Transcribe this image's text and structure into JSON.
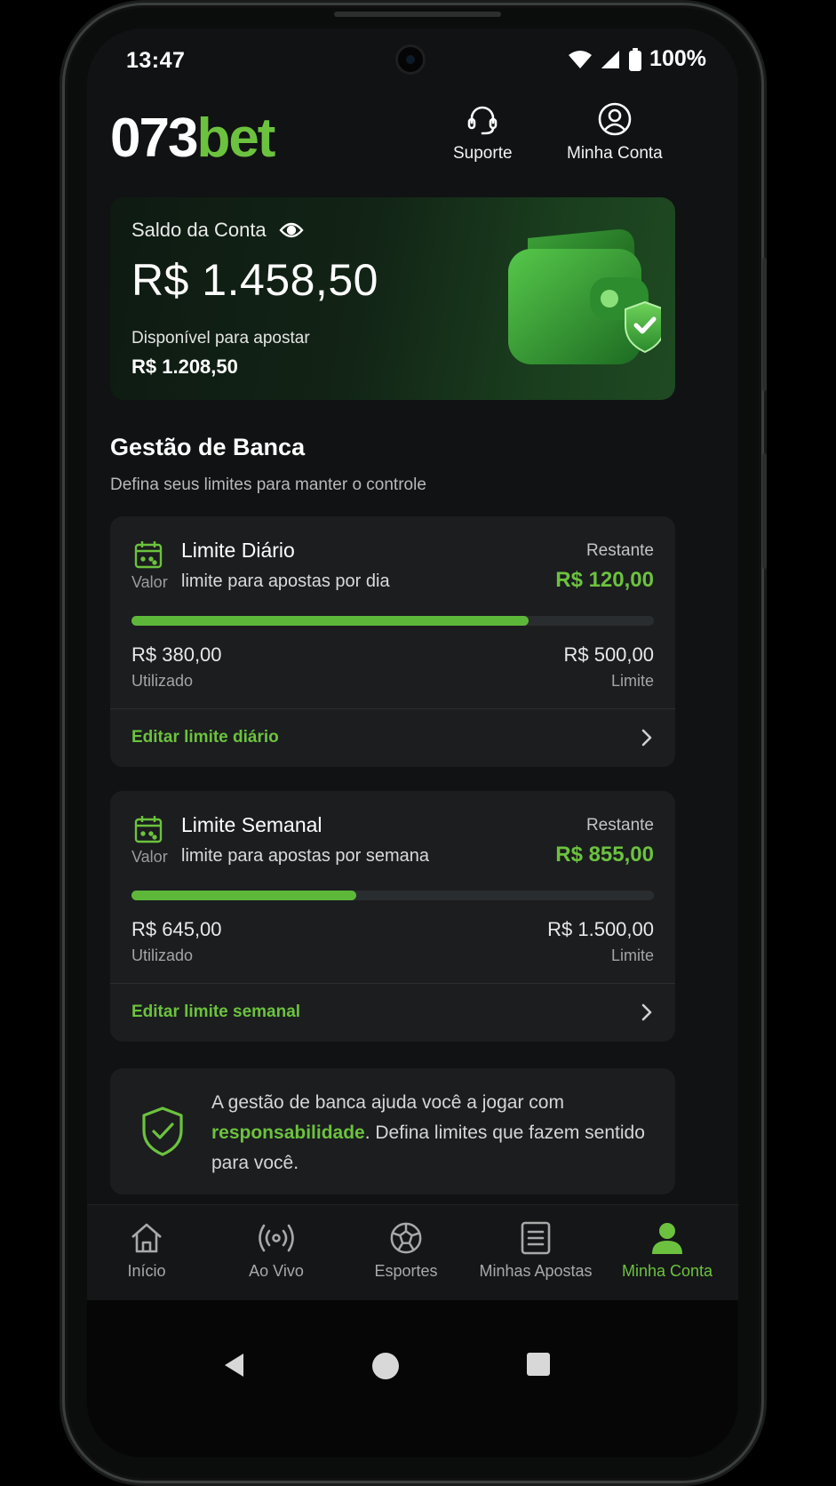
{
  "status_bar": {
    "time": "13:47",
    "battery": "100%"
  },
  "header": {
    "logo_num": "073",
    "logo_bet": "bet",
    "support_label": "Suporte",
    "account_label": "Minha Conta"
  },
  "balance": {
    "title": "Saldo da Conta",
    "amount": "R$ 1.458,50",
    "available_label": "Disponível para apostar",
    "available_amount": "R$ 1.208,50"
  },
  "section": {
    "title": "Gestão de Banca",
    "subtitle": "Defina seus limites para manter o controle"
  },
  "limits": [
    {
      "title": "Limite Diário",
      "valor_label": "Valor",
      "description": "limite para apostas por dia",
      "remaining_label": "Restante",
      "remaining": "R$ 120,00",
      "progress_pct": 76,
      "used": "R$ 380,00",
      "used_label": "Utilizado",
      "limit": "R$ 500,00",
      "limit_label": "Limite",
      "edit_label": "Editar limite diário"
    },
    {
      "title": "Limite Semanal",
      "valor_label": "Valor",
      "description": "limite para apostas por semana",
      "remaining_label": "Restante",
      "remaining": "R$ 855,00",
      "progress_pct": 43,
      "used": "R$ 645,00",
      "used_label": "Utilizado",
      "limit": "R$ 1.500,00",
      "limit_label": "Limite",
      "edit_label": "Editar limite semanal"
    }
  ],
  "info": {
    "text_before": "A gestão de banca ajuda você a jogar com ",
    "highlight": "responsabilidade",
    "text_after": ". Defina limites que fazem sentido para você."
  },
  "bottom_nav": {
    "items": [
      {
        "label": "Início",
        "icon": "home-icon"
      },
      {
        "label": "Ao Vivo",
        "icon": "live-broadcast-icon"
      },
      {
        "label": "Esportes",
        "icon": "soccer-ball-icon"
      },
      {
        "label": "Minhas Apostas",
        "icon": "receipt-icon"
      },
      {
        "label": "Minha Conta",
        "icon": "user-icon",
        "active": true
      }
    ]
  },
  "colors": {
    "accent": "#6cc23e",
    "background": "#111213",
    "card": "#1b1d1f"
  }
}
